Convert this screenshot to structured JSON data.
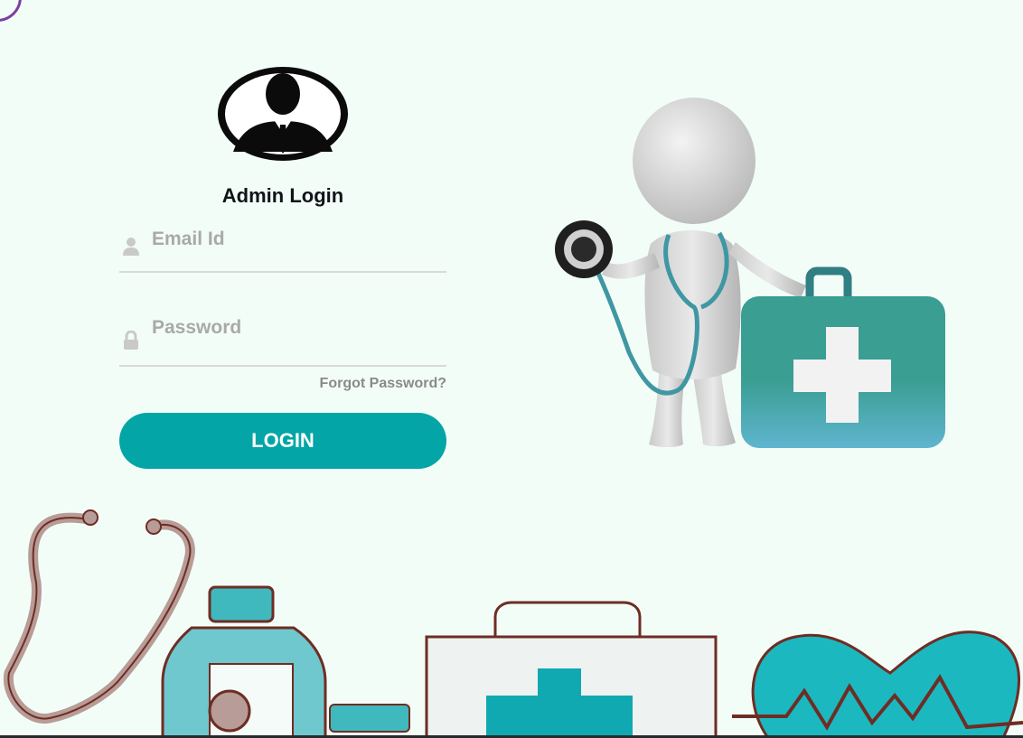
{
  "login": {
    "title": "Admin Login",
    "email_placeholder": "Email Id",
    "password_placeholder": "Password",
    "forgot_link": "Forgot Password?",
    "login_button": "LOGIN"
  },
  "colors": {
    "background": "#f3fdf8",
    "accent": "#03a5a6",
    "placeholder": "#a9a9a9",
    "forgot_text": "#8a8a8a"
  },
  "icons": [
    "admin-avatar-icon",
    "user-icon",
    "lock-icon"
  ]
}
